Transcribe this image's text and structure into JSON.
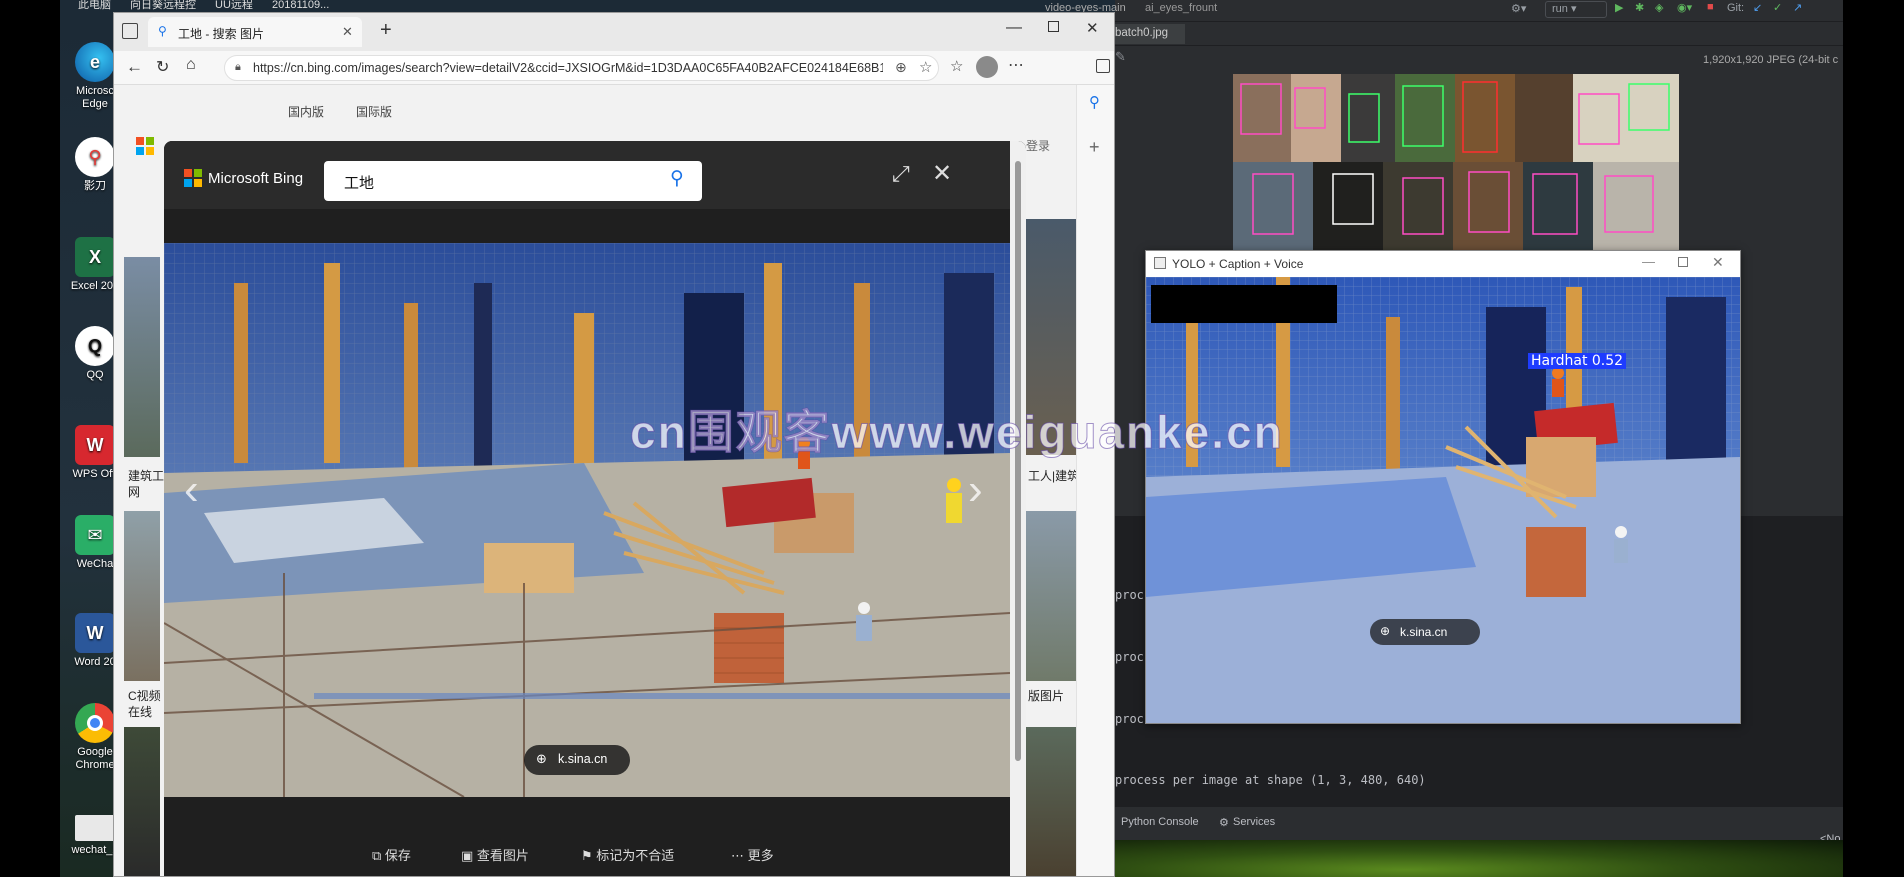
{
  "desktop": {
    "top_strip": [
      "此电脑",
      "向日葵远程控",
      "UU远程",
      "20181109..."
    ],
    "icons": [
      {
        "label": "Microsoft Edge",
        "line1": "Microsc",
        "line2": "Edge",
        "icon": "edge-icon",
        "color": "#1f8fd6"
      },
      {
        "label": "影刀",
        "line1": "影刀",
        "line2": "",
        "icon": "yingdao-icon",
        "color": "#e53935"
      },
      {
        "label": "Excel 201",
        "line1": "Excel 201",
        "line2": "",
        "icon": "excel-icon",
        "color": "#1e7145"
      },
      {
        "label": "QQ",
        "line1": "QQ",
        "line2": "",
        "icon": "qq-icon",
        "color": "#111111"
      },
      {
        "label": "WPS Offi",
        "line1": "WPS Offi",
        "line2": "",
        "icon": "wps-icon",
        "color": "#d7282f"
      },
      {
        "label": "WeCha",
        "line1": "WeCha",
        "line2": "",
        "icon": "wechat-icon",
        "color": "#2aae67"
      },
      {
        "label": "Word 20",
        "line1": "Word 20",
        "line2": "",
        "icon": "word-icon",
        "color": "#2b579a"
      },
      {
        "label": "Google Chrome",
        "line1": "Google",
        "line2": "Chrome",
        "icon": "chrome-icon",
        "color": "#4285f4"
      },
      {
        "label": "wechat_2",
        "line1": "wechat_2",
        "line2": "",
        "icon": "file-icon",
        "color": "#e8e8e8"
      }
    ]
  },
  "ide": {
    "top_items": [
      "video-eyes-main",
      "ai_eyes_frount"
    ],
    "run_label": "run",
    "git_label": "Git:",
    "file_tab": "batch0.jpg",
    "image_info": "1,920x1,920 JPEG (24-bit c",
    "console_lines": [
      "proc",
      "proc",
      "proc",
      "process per image at shape (1, 3, 480, 640)"
    ],
    "bottom_tabs": [
      "Python Console",
      "Services"
    ],
    "bottom_right": "<No"
  },
  "browser": {
    "tab_title": "工地 - 搜索 图片",
    "url": "https://cn.bing.com/images/search?view=detailV2&ccid=JXSIOGrM&id=1D3DAA0C65FA40B2AFCE024184E68B1...",
    "page_tabs": [
      "国内版",
      "国际版"
    ],
    "login_label": "登录",
    "bg_captions_left": [
      "建筑工",
      "网",
      "C视频",
      "在线"
    ],
    "bg_captions_right": [
      "工人|建筑",
      "版图片"
    ]
  },
  "viewer": {
    "brand": "Microsoft Bing",
    "search_value": "工地",
    "source_badge": "k.sina.cn",
    "actions": [
      {
        "label": "保存",
        "icon": "save-icon"
      },
      {
        "label": "查看图片",
        "icon": "view-image-icon"
      },
      {
        "label": "标记为不合适",
        "icon": "flag-icon"
      },
      {
        "label": "更多",
        "icon": "more-icon"
      }
    ]
  },
  "yolo_window": {
    "title": "YOLO + Caption + Voice",
    "detection_label": "Hardhat 0.52",
    "detection_color": "#1e3cff",
    "source_badge": "k.sina.cn"
  },
  "watermark": "cn围观客www.weiguanke.cn"
}
